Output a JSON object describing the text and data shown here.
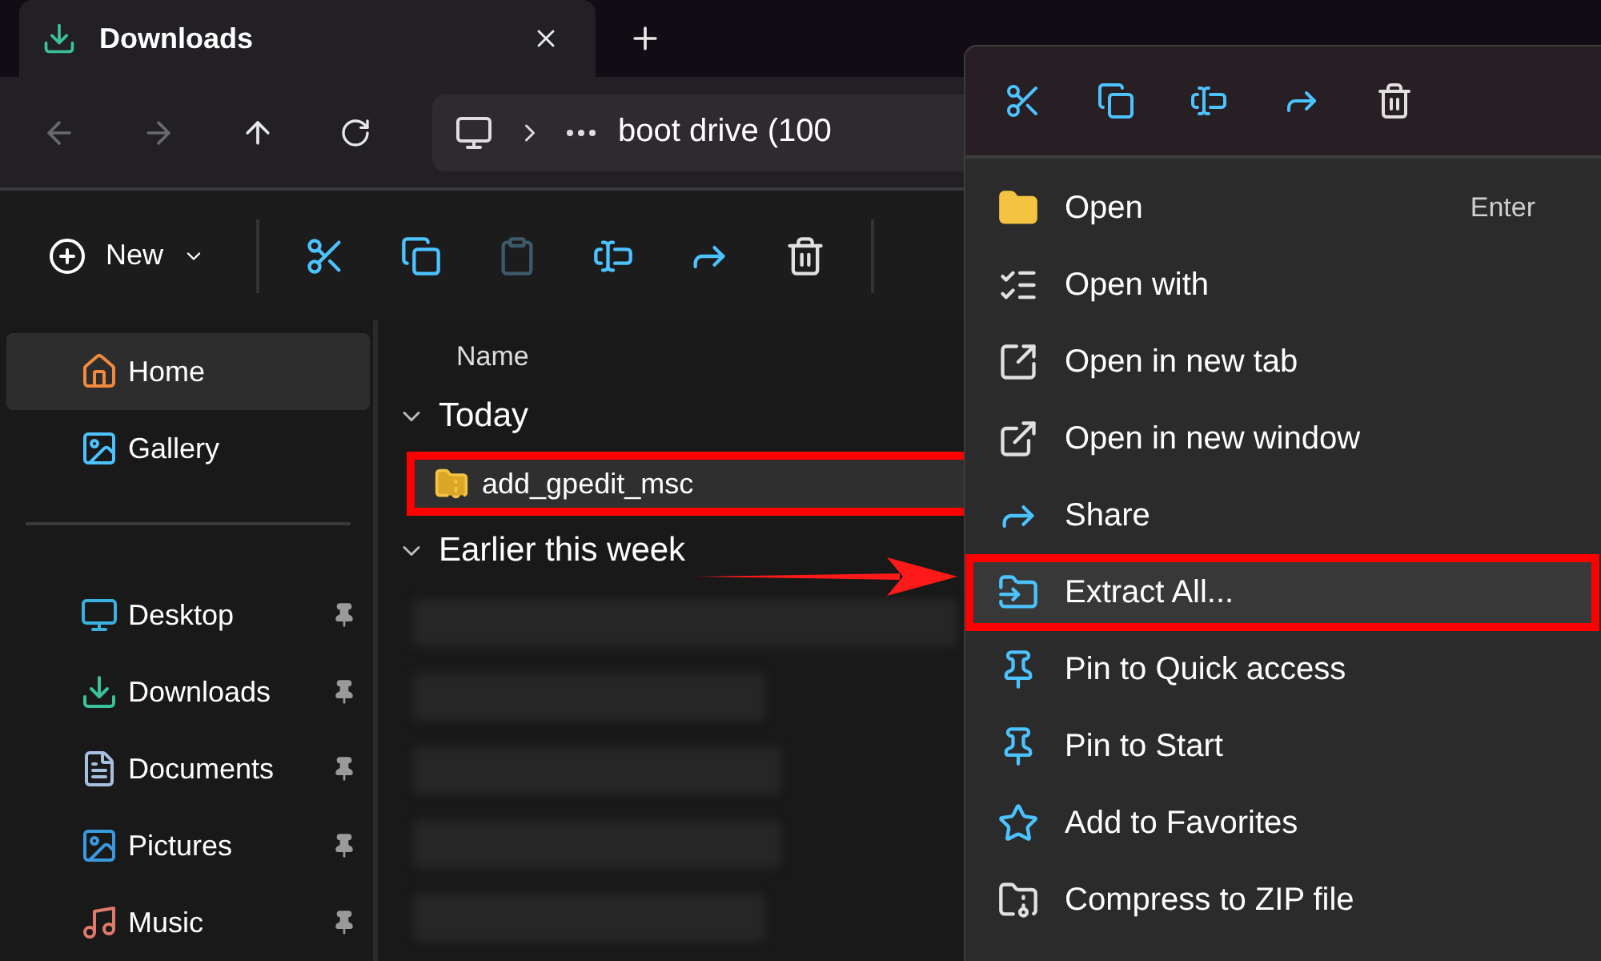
{
  "tab": {
    "title": "Downloads",
    "selected": true
  },
  "nav": {
    "back_disabled": true,
    "forward_disabled": true,
    "breadcrumb": "boot drive (100"
  },
  "toolbar": [
    {
      "kind": "new",
      "label": "New",
      "disabled": false
    },
    {
      "kind": "cut",
      "disabled": false
    },
    {
      "kind": "copy",
      "disabled": false
    },
    {
      "kind": "paste",
      "disabled": true
    },
    {
      "kind": "rename",
      "disabled": false
    },
    {
      "kind": "share",
      "disabled": false
    },
    {
      "kind": "delete",
      "disabled": false
    }
  ],
  "sidebar": {
    "items": [
      {
        "kind": "home",
        "label": "Home",
        "selected": true,
        "pinned": false
      },
      {
        "kind": "gallery",
        "label": "Gallery",
        "selected": false,
        "pinned": false
      },
      {
        "kind": "separator"
      },
      {
        "kind": "desktop",
        "label": "Desktop",
        "selected": false,
        "pinned": true
      },
      {
        "kind": "downloads",
        "label": "Downloads",
        "selected": false,
        "pinned": true
      },
      {
        "kind": "documents",
        "label": "Documents",
        "selected": false,
        "pinned": true
      },
      {
        "kind": "pictures",
        "label": "Pictures",
        "selected": false,
        "pinned": true
      },
      {
        "kind": "music",
        "label": "Music",
        "selected": false,
        "pinned": true
      }
    ]
  },
  "files": {
    "column": "Name",
    "groups": [
      {
        "title": "Today",
        "expanded": true,
        "rows": [
          {
            "name": "add_gpedit_msc",
            "highlighted": true
          }
        ]
      },
      {
        "title": "Earlier this week",
        "expanded": true
      }
    ]
  },
  "context_menu": {
    "actions": [
      {
        "kind": "cut"
      },
      {
        "kind": "copy"
      },
      {
        "kind": "rename"
      },
      {
        "kind": "share"
      },
      {
        "kind": "delete"
      }
    ],
    "items": [
      {
        "kind": "open",
        "label": "Open",
        "shortcut": "Enter",
        "highlighted": false
      },
      {
        "kind": "open-with",
        "label": "Open with",
        "highlighted": false
      },
      {
        "kind": "new-tab",
        "label": "Open in new tab",
        "highlighted": false
      },
      {
        "kind": "new-window",
        "label": "Open in new window",
        "highlighted": false
      },
      {
        "kind": "share",
        "label": "Share",
        "highlighted": false
      },
      {
        "kind": "extract",
        "label": "Extract All...",
        "highlighted": true
      },
      {
        "kind": "pin-quick",
        "label": "Pin to Quick access",
        "highlighted": false
      },
      {
        "kind": "pin-start",
        "label": "Pin to Start",
        "highlighted": false
      },
      {
        "kind": "favorite",
        "label": "Add to Favorites",
        "highlighted": false
      },
      {
        "kind": "zip",
        "label": "Compress to ZIP file",
        "highlighted": false
      }
    ]
  }
}
